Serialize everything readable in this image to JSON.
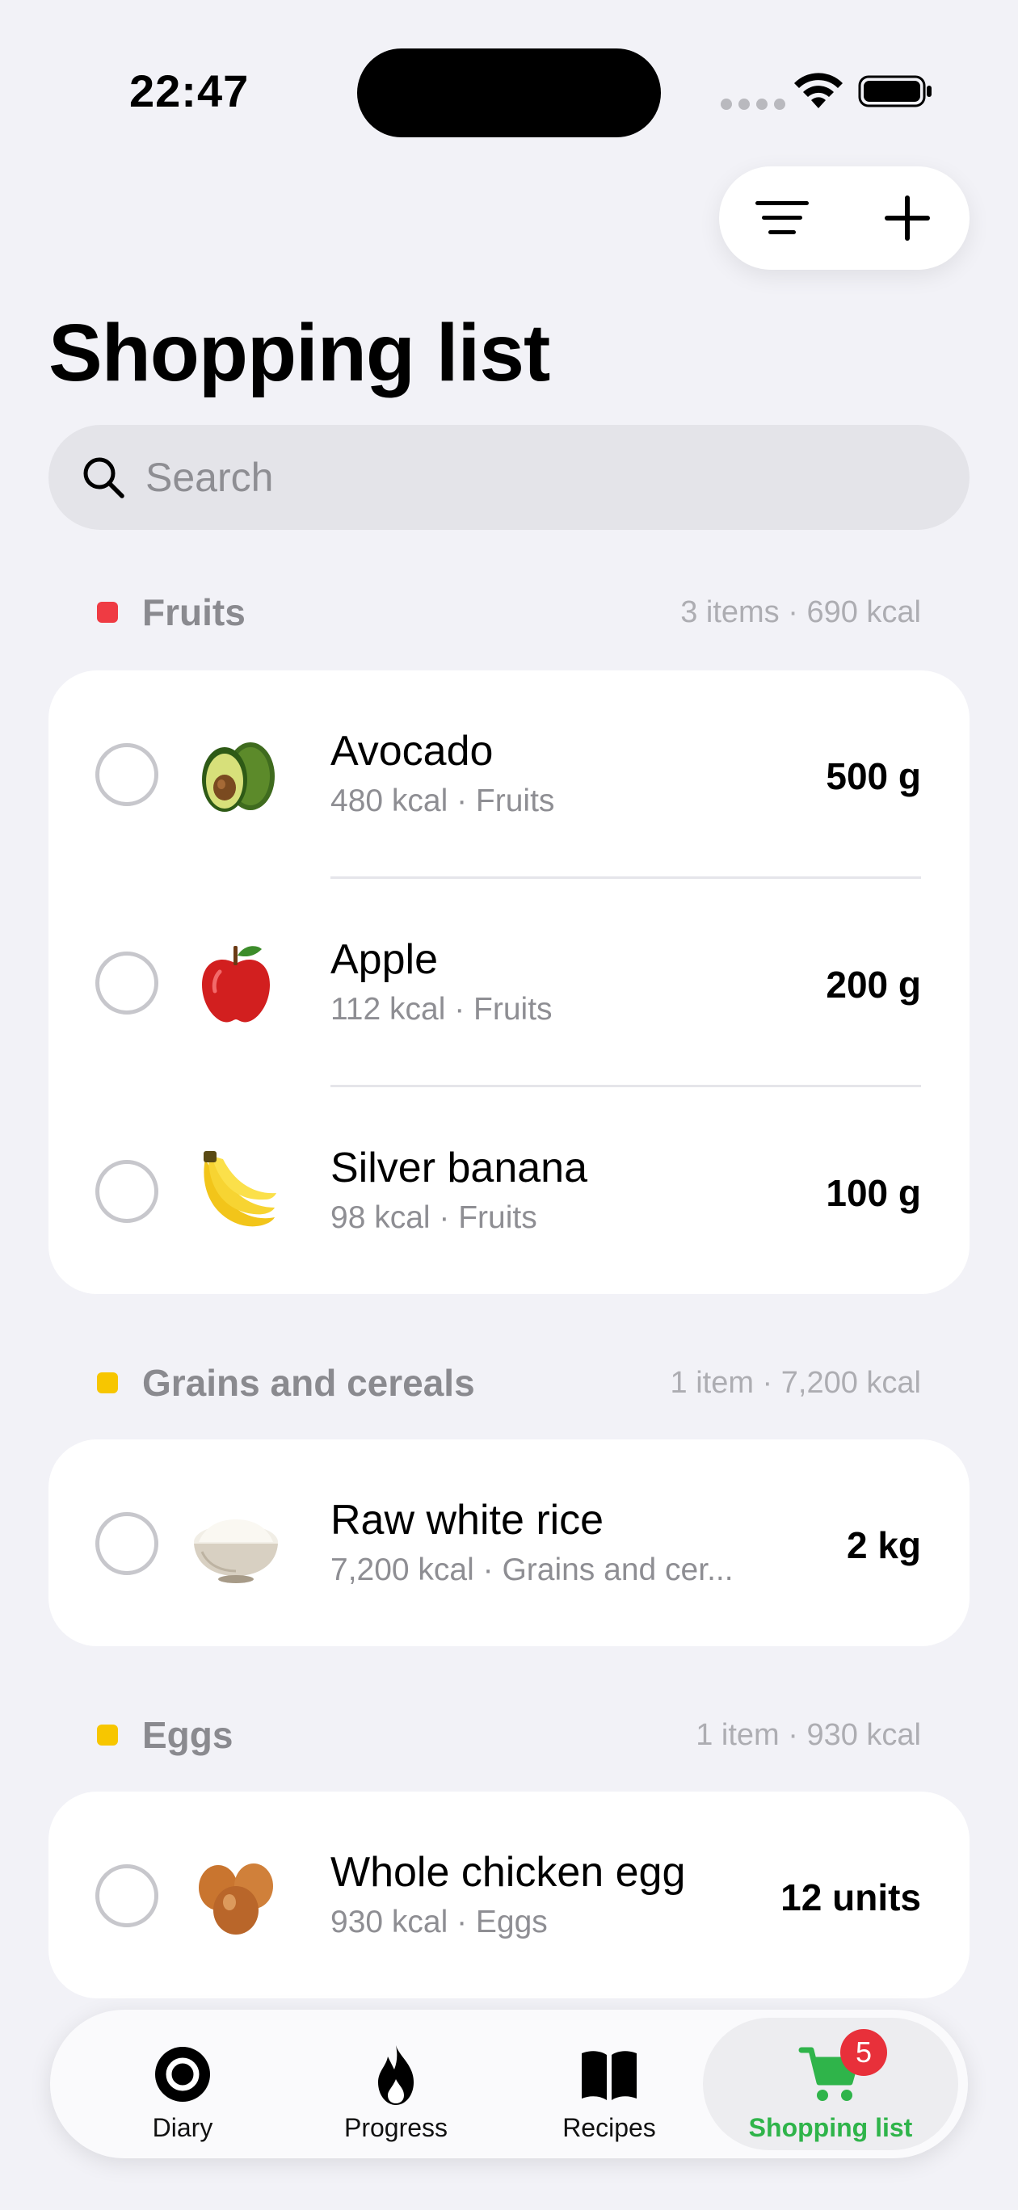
{
  "status_bar": {
    "time": "22:47"
  },
  "header": {
    "filter_icon": "filter-lines-icon",
    "add_icon": "plus-icon"
  },
  "page": {
    "title": "Shopping list"
  },
  "search": {
    "placeholder": "Search"
  },
  "sections": [
    {
      "name": "Fruits",
      "color": "#EF3B43",
      "meta": "3 items · 690 kcal",
      "items": [
        {
          "name": "Avocado",
          "detail": "480 kcal · Fruits",
          "quantity": "500 g",
          "icon": "avocado-icon"
        },
        {
          "name": "Apple",
          "detail": "112 kcal · Fruits",
          "quantity": "200 g",
          "icon": "apple-icon"
        },
        {
          "name": "Silver banana",
          "detail": "98 kcal · Fruits",
          "quantity": "100 g",
          "icon": "banana-icon"
        }
      ]
    },
    {
      "name": "Grains and cereals",
      "color": "#F7C600",
      "meta": "1 item · 7,200 kcal",
      "items": [
        {
          "name": "Raw white rice",
          "detail": "7,200 kcal · Grains and cer...",
          "quantity": "2 kg",
          "icon": "rice-bowl-icon"
        }
      ]
    },
    {
      "name": "Eggs",
      "color": "#F7C600",
      "meta": "1 item · 930 kcal",
      "items": [
        {
          "name": "Whole chicken egg",
          "detail": "930 kcal · Eggs",
          "quantity": "12 units",
          "icon": "eggs-icon"
        }
      ]
    }
  ],
  "tabs": [
    {
      "label": "Diary",
      "icon": "diary-ring-icon",
      "active": false
    },
    {
      "label": "Progress",
      "icon": "flame-icon",
      "active": false
    },
    {
      "label": "Recipes",
      "icon": "open-book-icon",
      "active": false
    },
    {
      "label": "Shopping list",
      "icon": "cart-icon",
      "active": true,
      "badge": "5"
    }
  ],
  "colors": {
    "accent_green": "#2FB44A",
    "badge_red": "#E8303A",
    "background": "#F2F2F7"
  }
}
